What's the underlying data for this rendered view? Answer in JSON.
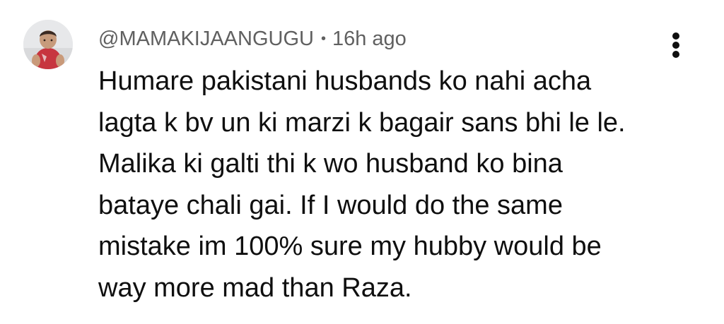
{
  "comment": {
    "author_handle": "@MAMAKIJAANGUGU",
    "separator": "•",
    "timestamp": "16h ago",
    "avatar_icon": "child-photo-avatar",
    "menu_icon": "more-vertical-icon",
    "text_lines": [
      "Humare pakistani husbands ko nahi acha",
      "lagta k bv un ki marzi k bagair sans bhi le le.",
      "Malika ki galti thi k wo husband ko bina",
      "bataye chali gai. If I would do the same",
      "mistake im 100% sure my hubby would be",
      "way more mad than Raza."
    ]
  },
  "colors": {
    "background": "#ffffff",
    "text_primary": "#0f0f0f",
    "text_secondary": "#606060"
  }
}
